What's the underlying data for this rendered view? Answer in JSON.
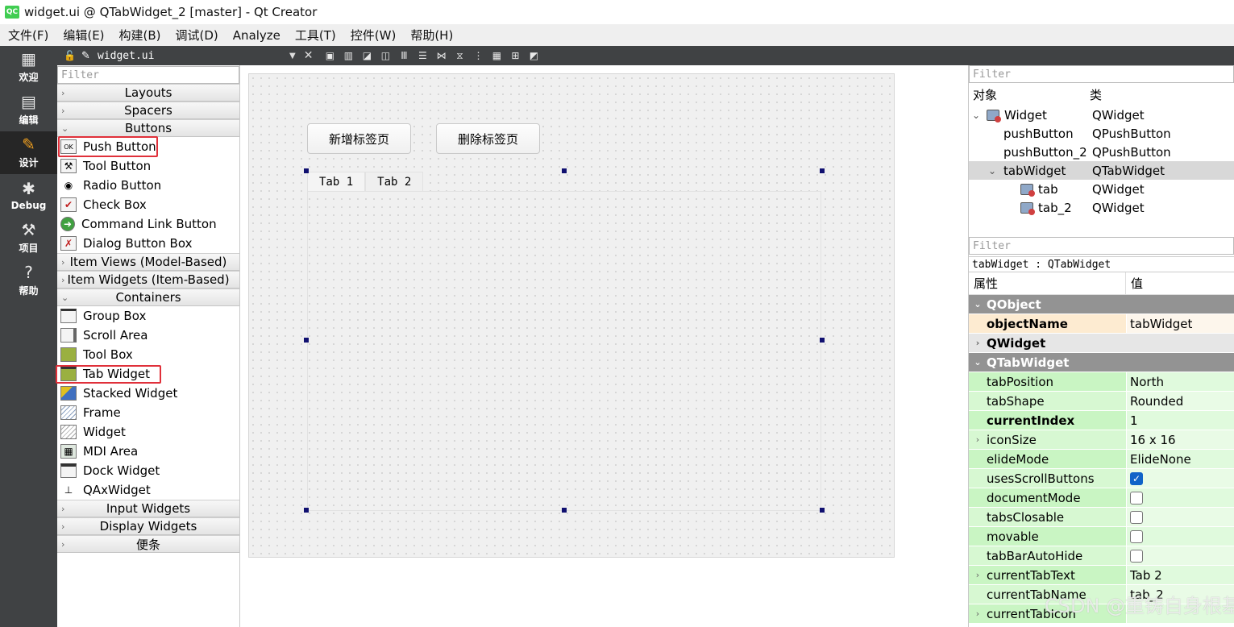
{
  "window": {
    "title": "widget.ui @ QTabWidget_2 [master] - Qt Creator",
    "logo_text": "QC"
  },
  "menu": [
    "文件(F)",
    "编辑(E)",
    "构建(B)",
    "调试(D)",
    "Analyze",
    "工具(T)",
    "控件(W)",
    "帮助(H)"
  ],
  "modes": [
    {
      "label": "欢迎",
      "icon": "▦"
    },
    {
      "label": "编辑",
      "icon": "▤"
    },
    {
      "label": "设计",
      "icon": "✎"
    },
    {
      "label": "Debug",
      "icon": "✱"
    },
    {
      "label": "项目",
      "icon": "⚒"
    },
    {
      "label": "帮助",
      "icon": "?"
    }
  ],
  "editor_toolbar": {
    "filename": "widget.ui",
    "buttons": [
      "▣",
      "▥",
      "◪",
      "◫",
      "Ⅲ",
      "☰",
      "⋈",
      "⧖",
      "⋮",
      "▦",
      "⊞",
      "◩"
    ]
  },
  "widget_box": {
    "filter_placeholder": "Filter",
    "categories": {
      "layouts": "Layouts",
      "spacers": "Spacers",
      "buttons": "Buttons",
      "item_views": "Item Views (Model-Based)",
      "item_widgets": "Item Widgets (Item-Based)",
      "containers": "Containers",
      "input_widgets": "Input Widgets",
      "display_widgets": "Display Widgets",
      "misc": "便条"
    },
    "button_items": [
      "Push Button",
      "Tool Button",
      "Radio Button",
      "Check Box",
      "Command Link Button",
      "Dialog Button Box"
    ],
    "container_items": [
      "Group Box",
      "Scroll Area",
      "Tool Box",
      "Tab Widget",
      "Stacked Widget",
      "Frame",
      "Widget",
      "MDI Area",
      "Dock Widget",
      "QAxWidget"
    ]
  },
  "form": {
    "add_tab_button": "新增标签页",
    "delete_tab_button": "删除标签页",
    "tabs": [
      "Tab 1",
      "Tab 2"
    ]
  },
  "object_inspector": {
    "filter_placeholder": "Filter",
    "col_object": "对象",
    "col_class": "类",
    "rows": [
      {
        "name": "Widget",
        "class": "QWidget"
      },
      {
        "name": "pushButton",
        "class": "QPushButton"
      },
      {
        "name": "pushButton_2",
        "class": "QPushButton"
      },
      {
        "name": "tabWidget",
        "class": "QTabWidget"
      },
      {
        "name": "tab",
        "class": "QWidget"
      },
      {
        "name": "tab_2",
        "class": "QWidget"
      }
    ]
  },
  "property_editor": {
    "filter_placeholder": "Filter",
    "object_title": "tabWidget : QTabWidget",
    "col_property": "属性",
    "col_value": "值",
    "group_qobject": "QObject",
    "objectName": {
      "name": "objectName",
      "value": "tabWidget"
    },
    "group_qwidget": "QWidget",
    "group_qtabwidget": "QTabWidget",
    "tabPosition": {
      "name": "tabPosition",
      "value": "North"
    },
    "tabShape": {
      "name": "tabShape",
      "value": "Rounded"
    },
    "currentIndex": {
      "name": "currentIndex",
      "value": "1"
    },
    "iconSize": {
      "name": "iconSize",
      "value": "16 x 16"
    },
    "elideMode": {
      "name": "elideMode",
      "value": "ElideNone"
    },
    "usesScrollButtons": {
      "name": "usesScrollButtons",
      "checked": true
    },
    "documentMode": {
      "name": "documentMode",
      "checked": false
    },
    "tabsClosable": {
      "name": "tabsClosable",
      "checked": false
    },
    "movable": {
      "name": "movable",
      "checked": false
    },
    "tabBarAutoHide": {
      "name": "tabBarAutoHide",
      "checked": false
    },
    "currentTabText": {
      "name": "currentTabText",
      "value": "Tab 2"
    },
    "currentTabName": {
      "name": "currentTabName",
      "value": "tab_2"
    },
    "currentTabIcon": {
      "name": "currentTabIcon",
      "value": ""
    }
  },
  "watermark": "CSDN @重铸自身根基"
}
